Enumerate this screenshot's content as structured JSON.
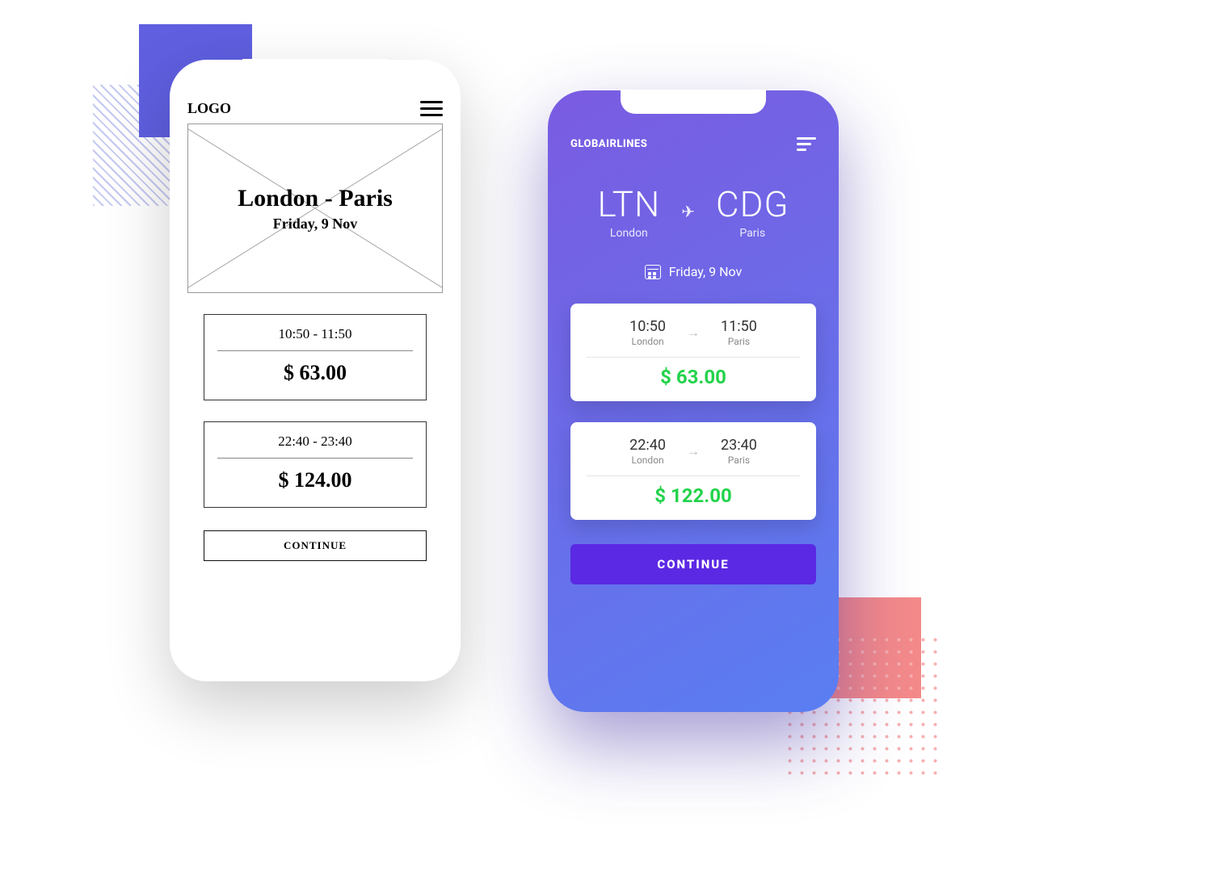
{
  "wireframe": {
    "logo": "LOGO",
    "title": "London - Paris",
    "date": "Friday, 9 Nov",
    "flights": [
      {
        "times": "10:50 - 11:50",
        "price": "$ 63.00"
      },
      {
        "times": "22:40 - 23:40",
        "price": "$ 124.00"
      }
    ],
    "continue": "CONTINUE"
  },
  "design": {
    "brand": "GLOBAIRLINES",
    "origin_code": "LTN",
    "origin_city": "London",
    "dest_code": "CDG",
    "dest_city": "Paris",
    "date": "Friday, 9 Nov",
    "flights": [
      {
        "dep_time": "10:50",
        "dep_city": "London",
        "arr_time": "11:50",
        "arr_city": "Paris",
        "price": "$ 63.00"
      },
      {
        "dep_time": "22:40",
        "dep_city": "London",
        "arr_time": "23:40",
        "arr_city": "Paris",
        "price": "$ 122.00"
      }
    ],
    "continue": "CONTINUE"
  },
  "colors": {
    "purple_accent": "#5f5fe0",
    "gradient_start": "#7a5be2",
    "gradient_end": "#5a7ef2",
    "continue_btn": "#5b29e4",
    "price_green": "#22d34a",
    "pink_accent": "#f48a8a"
  }
}
